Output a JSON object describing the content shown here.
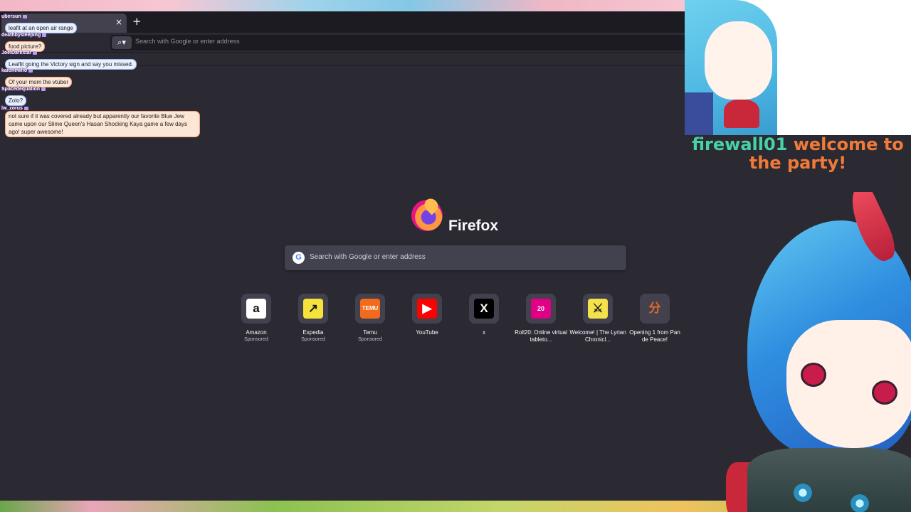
{
  "chat": [
    {
      "user": "ubersun",
      "message": "leafit at an open air range",
      "style": "blue"
    },
    {
      "user": "deathbysleeping",
      "message": "food picture?",
      "style": "peach"
    },
    {
      "user": "JoelDarkstar",
      "message": "Leaflit going the Victory sign and say you missed.",
      "style": "blue"
    },
    {
      "user": "kaionewho",
      "message": "Of your mom the vtuber",
      "style": "peach"
    },
    {
      "user": "Spacedequation",
      "message": "Zolo?",
      "style": "blue"
    },
    {
      "user": "lw_zorus",
      "message": "not sure if it was covered already but apparently our favorite Blue Jew came upon our Slime Queen's Hasan Shocking Kaya game a few days ago! super awesome!",
      "style": "peach"
    }
  ],
  "browser": {
    "tab_close": "×",
    "new_tab": "+",
    "urlbar_placeholder": "Search with Google or enter address",
    "search_engine_icon": "search-icon"
  },
  "newtab": {
    "wordmark": "Firefox",
    "search_placeholder": "Search with Google or enter address",
    "google_letter": "G",
    "shortcuts": [
      {
        "title": "Amazon",
        "subtitle": "Sponsored",
        "glyph": "a",
        "bg": "#ffffff",
        "fg": "#111111"
      },
      {
        "title": "Expedia",
        "subtitle": "Sponsored",
        "glyph": "↗",
        "bg": "#f5e23a",
        "fg": "#1a1a1a"
      },
      {
        "title": "Temu",
        "subtitle": "Sponsored",
        "glyph": "TEMU",
        "bg": "#f26b1d",
        "fg": "#ffffff"
      },
      {
        "title": "YouTube",
        "subtitle": "",
        "glyph": "▶",
        "bg": "#ff0000",
        "fg": "#ffffff"
      },
      {
        "title": "x",
        "subtitle": "",
        "glyph": "X",
        "bg": "#000000",
        "fg": "#ffffff"
      },
      {
        "title": "Roll20: Online virtual tableto...",
        "subtitle": "",
        "glyph": "20",
        "bg": "#e10085",
        "fg": "#ffffff"
      },
      {
        "title": "Welcome! | The Lyrian Chronicl...",
        "subtitle": "",
        "glyph": "⚔",
        "bg": "#f3e24a",
        "fg": "#222222"
      },
      {
        "title": "Opening 1 from Pan de Peace!",
        "subtitle": "",
        "glyph": "分",
        "bg": "#42414d",
        "fg": "#e06a2a"
      }
    ]
  },
  "overlay": {
    "welcome_name": "firewall01",
    "welcome_text": " welcome to the party!"
  }
}
